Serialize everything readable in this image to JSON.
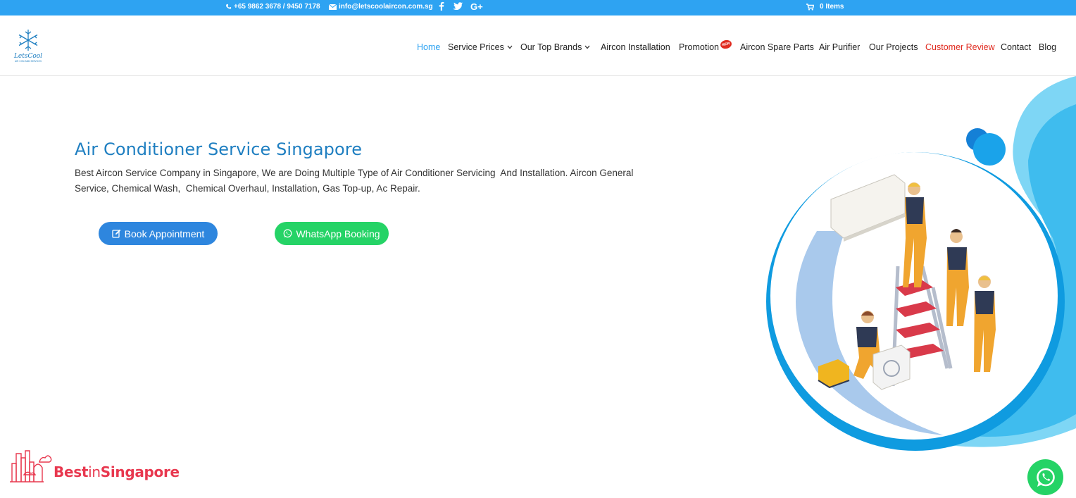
{
  "topbar": {
    "phone": "+65 9862 3678 / 9450 7178",
    "email": "info@letscoolaircon.com.sg",
    "social_icons": [
      "facebook-icon",
      "twitter-icon",
      "google-plus-icon"
    ],
    "cart_label": "0 Items"
  },
  "logo": {
    "name": "LetsCool",
    "tagline": "AIR CON AND SERVICES"
  },
  "nav": {
    "items": [
      {
        "label": "Home",
        "active": true
      },
      {
        "label": "Service Prices",
        "dropdown": true
      },
      {
        "label": "Our Top Brands",
        "dropdown": true
      },
      {
        "label": "Aircon Installation"
      },
      {
        "label": "Promotion",
        "badge": "NEW"
      },
      {
        "label": "Aircon Spare Parts"
      },
      {
        "label": "Air Purifier"
      },
      {
        "label": "Our Projects"
      },
      {
        "label": "Customer Review",
        "highlight": "#e02b20"
      },
      {
        "label": "Contact"
      },
      {
        "label": "Blog"
      }
    ]
  },
  "hero": {
    "title": "Air Conditioner Service Singapore",
    "description": "Best Aircon Service Company in Singapore, We are Doing Multiple Type of Air Conditioner Servicing  And Installation. Aircon General Service, Chemical Wash,  Chemical Overhaul, Installation, Gas Top-up, Ac Repair.",
    "book_button": "Book Appointment",
    "whatsapp_button": "WhatsApp Booking"
  },
  "footer_badge": {
    "best": "Best",
    "in": "in",
    "singapore": "Singapore"
  },
  "colors": {
    "topbar": "#2ea3f2",
    "accent": "#2ea3f2",
    "title": "#1f7fc1",
    "book_button": "#2e86de",
    "whatsapp": "#25d366",
    "review": "#e02b20",
    "bis_red": "#e8384f"
  }
}
